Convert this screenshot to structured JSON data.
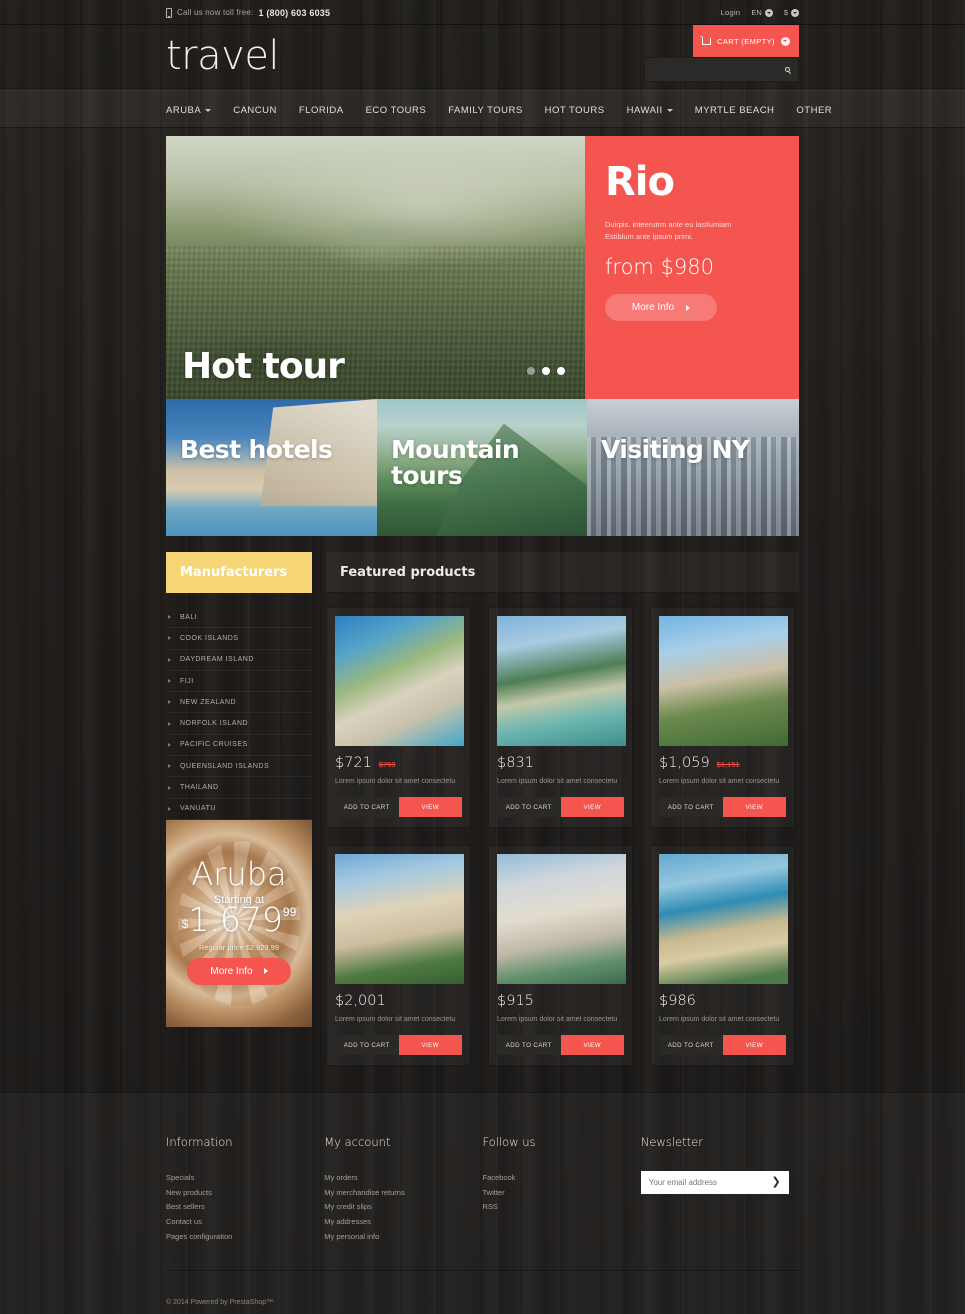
{
  "topbar": {
    "call_label": "Call us now toll free:",
    "phone": "1 (800) 603 6035",
    "login": "Login",
    "language": "EN",
    "currency": "$"
  },
  "header": {
    "logo": "travel",
    "cart_label": "CART (EMPTY)",
    "search_placeholder": ""
  },
  "nav": {
    "items": [
      {
        "label": "ARUBA",
        "has_dropdown": true
      },
      {
        "label": "CANCUN",
        "has_dropdown": false
      },
      {
        "label": "FLORIDA",
        "has_dropdown": false
      },
      {
        "label": "ECO TOURS",
        "has_dropdown": false
      },
      {
        "label": "FAMILY TOURS",
        "has_dropdown": false
      },
      {
        "label": "HOT TOURS",
        "has_dropdown": false
      },
      {
        "label": "HAWAII",
        "has_dropdown": true
      },
      {
        "label": "MYRTLE BEACH",
        "has_dropdown": false
      },
      {
        "label": "OTHER",
        "has_dropdown": false
      }
    ]
  },
  "hero": {
    "image_caption": "Hot tour",
    "title": "Rio",
    "description": "Duirpis. inteerutrm ante eu lastlumiam Estiblum ante ipsum primi.",
    "price": "from $980",
    "button": "More Info",
    "slides": 3,
    "active_slide": 2
  },
  "tiles": [
    {
      "label": "Best hotels"
    },
    {
      "label": "Mountain tours"
    },
    {
      "label": "Visiting NY"
    }
  ],
  "sidebar": {
    "title": "Manufacturers",
    "items": [
      {
        "label": "BALI"
      },
      {
        "label": "COOK ISLANDS"
      },
      {
        "label": "DAYDREAM ISLAND"
      },
      {
        "label": "FIJI"
      },
      {
        "label": "NEW ZEALAND"
      },
      {
        "label": "NORFOLK ISLAND"
      },
      {
        "label": "PACIFIC CRUISES"
      },
      {
        "label": "QUEENSLAND ISLANDS"
      },
      {
        "label": "THAILAND"
      },
      {
        "label": "VANUATU"
      }
    ]
  },
  "aruba_promo": {
    "title": "Aruba",
    "starting_at": "Starting at",
    "currency": "$",
    "amount": "1.679",
    "cents": "99",
    "regular_price": "Regular price $2.929.99",
    "button": "More Info"
  },
  "featured": {
    "title": "Featured products",
    "add_to_cart_label": "ADD TO CART",
    "view_label": "VIEW",
    "description": "Lorem ipsum dolor sit amet consectetu",
    "products": [
      {
        "price": "$721",
        "old_price": "$759",
        "image": "resort"
      },
      {
        "price": "$831",
        "old_price": "",
        "image": "pool"
      },
      {
        "price": "$1,059",
        "old_price": "$1,151",
        "image": "tower"
      },
      {
        "price": "$2,001",
        "old_price": "",
        "image": "hotel"
      },
      {
        "price": "$915",
        "old_price": "",
        "image": "terrace"
      },
      {
        "price": "$986",
        "old_price": "",
        "image": "beach"
      }
    ]
  },
  "footer": {
    "columns": [
      {
        "title": "Information",
        "links": [
          "Specials",
          "New products",
          "Best sellers",
          "Contact us",
          "Pages configuration"
        ]
      },
      {
        "title": "My account",
        "links": [
          "My orders",
          "My merchandise returns",
          "My credit slips",
          "My addresses",
          "My personal info"
        ]
      },
      {
        "title": "Follow us",
        "links": [
          "Facebook",
          "Twitter",
          "RSS"
        ]
      }
    ],
    "newsletter": {
      "title": "Newsletter",
      "placeholder": "Your email address",
      "submit_icon": "❯"
    },
    "copyright": "© 2014 Powered by PrestaShop™"
  },
  "colors": {
    "accent": "#f4554f",
    "sidebar_header": "#f5d575",
    "background": "#252321"
  }
}
